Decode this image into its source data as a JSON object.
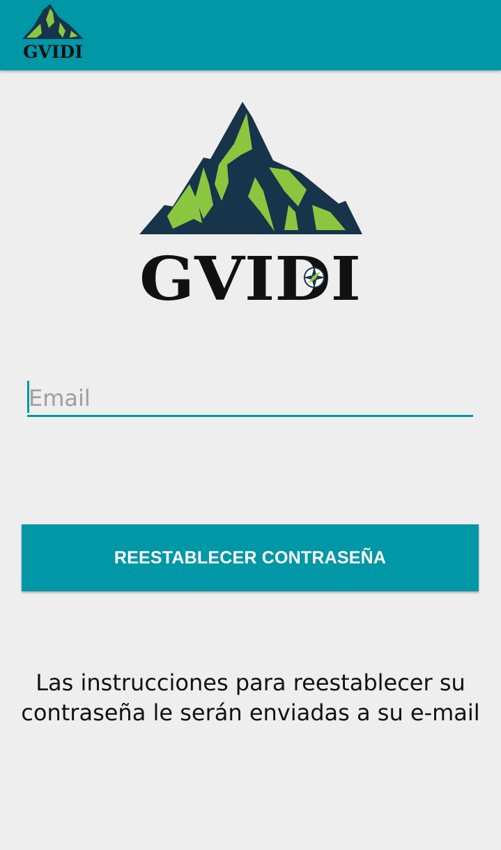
{
  "app_bar": {
    "logo_text": "GVIDI",
    "logo_icon": "mountain-logo-icon",
    "background_color": "#0097a7"
  },
  "main_logo": {
    "logo_text": "GVIDI",
    "logo_icon": "mountain-compass-logo-icon",
    "colors": {
      "mountain_dark": "#17344b",
      "mountain_green": "#8cc63f",
      "text": "#111111"
    }
  },
  "email_field": {
    "placeholder": "Email",
    "value": "",
    "underline_color": "#0097a7"
  },
  "reset_button": {
    "label": "REESTABLECER CONTRASEÑA",
    "background_color": "#0097a7",
    "text_color": "#ffffff"
  },
  "instructions": {
    "line1": "Las instrucciones para reestablecer su",
    "line2": "contraseña le serán enviadas a su e-mail"
  }
}
